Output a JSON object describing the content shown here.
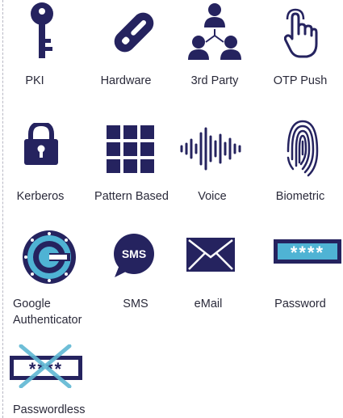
{
  "colors": {
    "navy": "#25235f",
    "teal": "#4fb3d4",
    "cross": "#5fb7d3",
    "text": "#2a2a3a"
  },
  "methods": [
    {
      "label": "PKI",
      "icon": "key-icon"
    },
    {
      "label": "Hardware",
      "icon": "usb-token-icon"
    },
    {
      "label": "3rd Party",
      "icon": "people-network-icon"
    },
    {
      "label": "OTP Push",
      "icon": "tap-finger-icon"
    },
    {
      "label": "Kerberos",
      "icon": "padlock-icon"
    },
    {
      "label": "Pattern Based",
      "icon": "grid-pattern-icon"
    },
    {
      "label": "Voice",
      "icon": "sound-wave-icon"
    },
    {
      "label": "Biometric",
      "icon": "fingerprint-icon"
    },
    {
      "label": "Google Authenticator",
      "label_lines": [
        "Google",
        "Authenticator"
      ],
      "icon": "google-authenticator-icon"
    },
    {
      "label": "SMS",
      "icon": "sms-bubble-icon",
      "icon_text": "SMS"
    },
    {
      "label": "eMail",
      "icon": "envelope-icon"
    },
    {
      "label": "Password",
      "icon": "password-field-icon",
      "icon_text": "****"
    },
    {
      "label": "Passwordless",
      "icon": "crossed-password-icon",
      "icon_text": "****"
    }
  ]
}
